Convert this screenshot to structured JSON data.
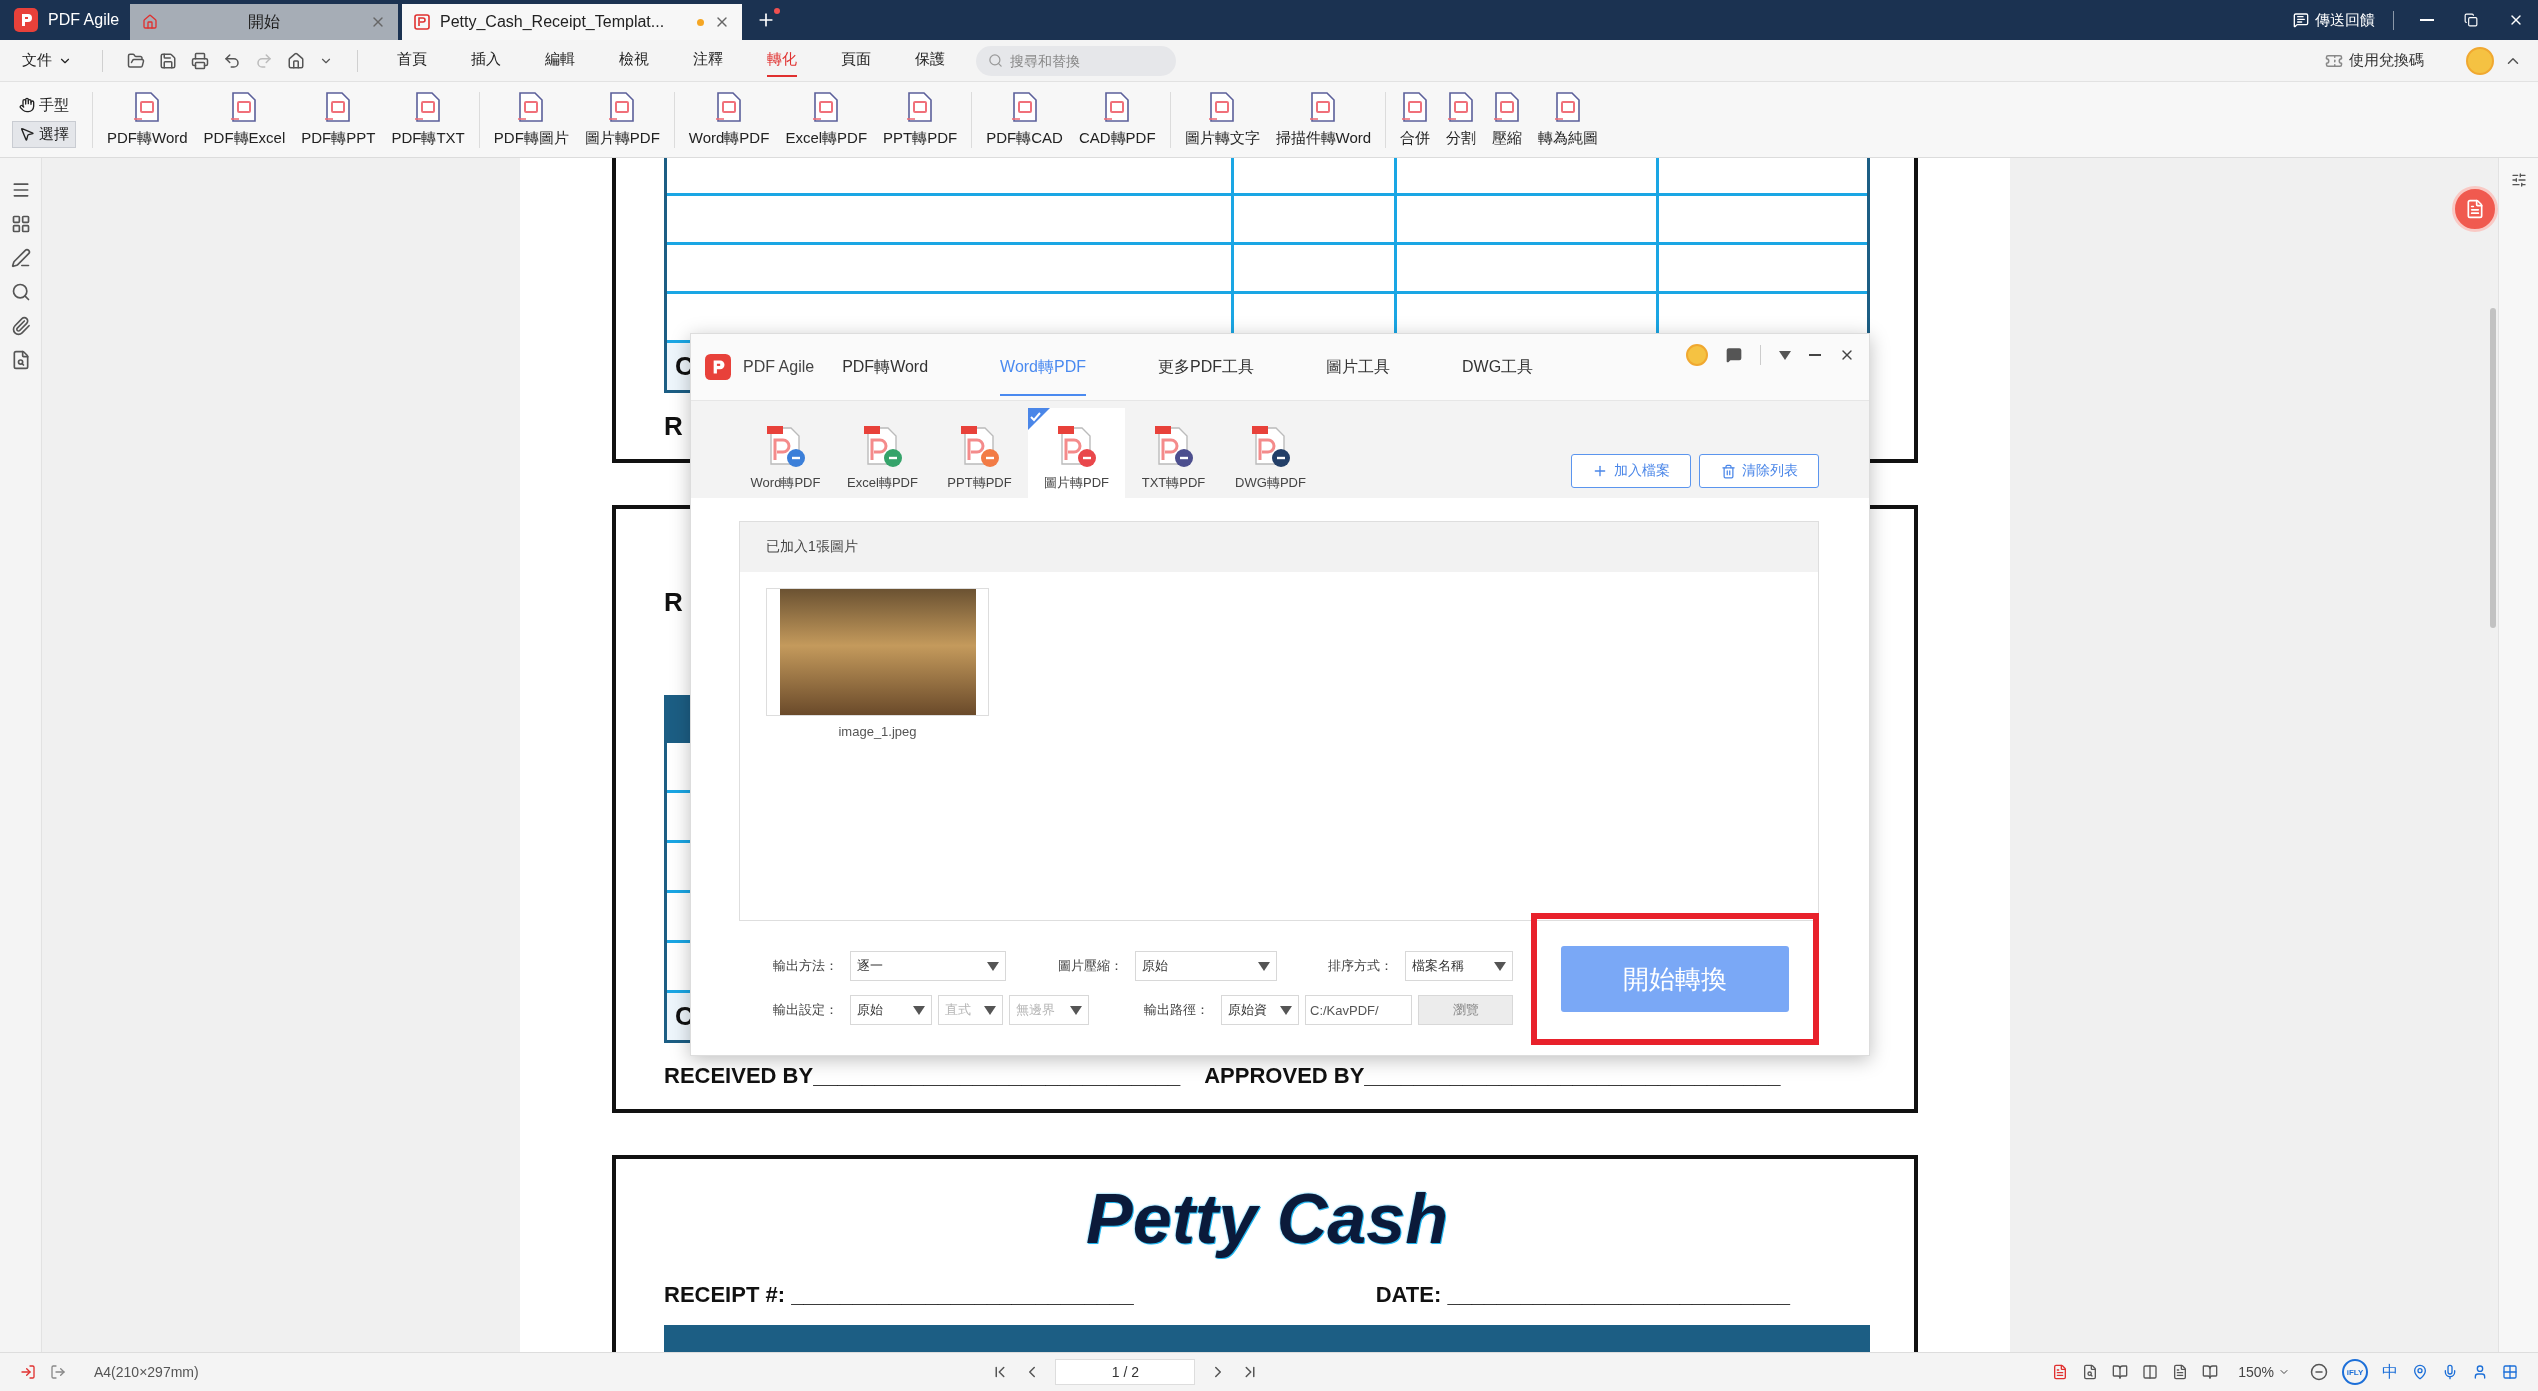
{
  "titlebar": {
    "app_name": "PDF Agile",
    "tabs": [
      {
        "label": "開始",
        "kind": "home",
        "selected": false,
        "modified": false
      },
      {
        "label": "Petty_Cash_Receipt_Templat...",
        "kind": "file",
        "selected": true,
        "modified": true
      }
    ],
    "feedback": "傳送回饋"
  },
  "menubar": {
    "file_menu": "文件",
    "tabs": [
      {
        "label": "首頁",
        "selected": false
      },
      {
        "label": "插入",
        "selected": false
      },
      {
        "label": "編輯",
        "selected": false
      },
      {
        "label": "檢視",
        "selected": false
      },
      {
        "label": "注釋",
        "selected": false
      },
      {
        "label": "轉化",
        "selected": true
      },
      {
        "label": "頁面",
        "selected": false
      },
      {
        "label": "保護",
        "selected": false
      }
    ],
    "search": {
      "placeholder": "搜尋和替換"
    },
    "redeem": "使用兌換碼"
  },
  "ribbon": {
    "modes": [
      {
        "label": "手型",
        "kind": "hand",
        "selected": false
      },
      {
        "label": "選擇",
        "kind": "select",
        "selected": true
      }
    ],
    "tool_groups": [
      [
        "PDF轉Word",
        "PDF轉Excel",
        "PDF轉PPT",
        "PDF轉TXT"
      ],
      [
        "PDF轉圖片",
        "圖片轉PDF"
      ],
      [
        "Word轉PDF",
        "Excel轉PDF",
        "PPT轉PDF"
      ],
      [
        "PDF轉CAD",
        "CAD轉PDF"
      ],
      [
        "圖片轉文字",
        "掃描件轉Word"
      ],
      [
        "合併",
        "分割",
        "壓縮",
        "轉為純圖"
      ]
    ]
  },
  "document": {
    "section_1": {
      "row_label": "C",
      "caption": "R"
    },
    "section_2": {
      "caption": "R",
      "row_label": "C",
      "received": "RECEIVED BY______________________________",
      "approved": "APPROVED BY__________________________________"
    },
    "section_3": {
      "title": "Petty Cash",
      "receipt": "RECEIPT #: ____________________________",
      "date": "DATE: ____________________________"
    }
  },
  "dialog": {
    "app_name": "PDF Agile",
    "tabs": [
      {
        "label": "PDF轉Word",
        "selected": false
      },
      {
        "label": "Word轉PDF",
        "selected": true
      },
      {
        "label": "更多PDF工具",
        "selected": false
      },
      {
        "label": "圖片工具",
        "selected": false
      },
      {
        "label": "DWG工具",
        "selected": false
      }
    ],
    "tools": [
      {
        "label": "Word轉PDF",
        "color": "#3b7fd9",
        "selected": false
      },
      {
        "label": "Excel轉PDF",
        "color": "#35a36a",
        "selected": false
      },
      {
        "label": "PPT轉PDF",
        "color": "#f27b45",
        "selected": false
      },
      {
        "label": "圖片轉PDF",
        "color": "#e9474b",
        "selected": true
      },
      {
        "label": "TXT轉PDF",
        "color": "#4c4e8e",
        "selected": false
      },
      {
        "label": "DWG轉PDF",
        "color": "#233f68",
        "selected": false
      }
    ],
    "add_button": "加入檔案",
    "clear_button": "清除列表",
    "list_header": "已加入1張圖片",
    "files": [
      {
        "name": "image_1.jpeg"
      }
    ],
    "options": [
      [
        {
          "label": "輸出方法：",
          "controls": [
            {
              "kind": "select",
              "value": "逐一",
              "disabled": false
            }
          ]
        },
        {
          "label": "圖片壓縮：",
          "controls": [
            {
              "kind": "select",
              "value": "原始",
              "disabled": false
            }
          ]
        },
        {
          "label": "排序方式：",
          "controls": [
            {
              "kind": "select",
              "value": "檔案名稱",
              "disabled": false
            }
          ]
        }
      ],
      [
        {
          "label": "輸出設定：",
          "controls": [
            {
              "kind": "select",
              "value": "原始",
              "disabled": false
            },
            {
              "kind": "select",
              "value": "直式",
              "disabled": true
            },
            {
              "kind": "select",
              "value": "無邊界",
              "disabled": true
            }
          ]
        },
        {
          "label": "輸出路徑：",
          "controls": [
            {
              "kind": "select",
              "value": "原始資",
              "disabled": false
            },
            {
              "kind": "field",
              "value": "C:/KavPDF/"
            },
            {
              "kind": "button",
              "label": "瀏覽",
              "disabled": true
            }
          ]
        }
      ]
    ],
    "start_button": "開始轉換"
  },
  "status_bar": {
    "page_size": "A4(210×297mm)",
    "page": "1 / 2",
    "zoom": "150%",
    "ime_badge": "iFLY",
    "ime_lang": "中"
  }
}
